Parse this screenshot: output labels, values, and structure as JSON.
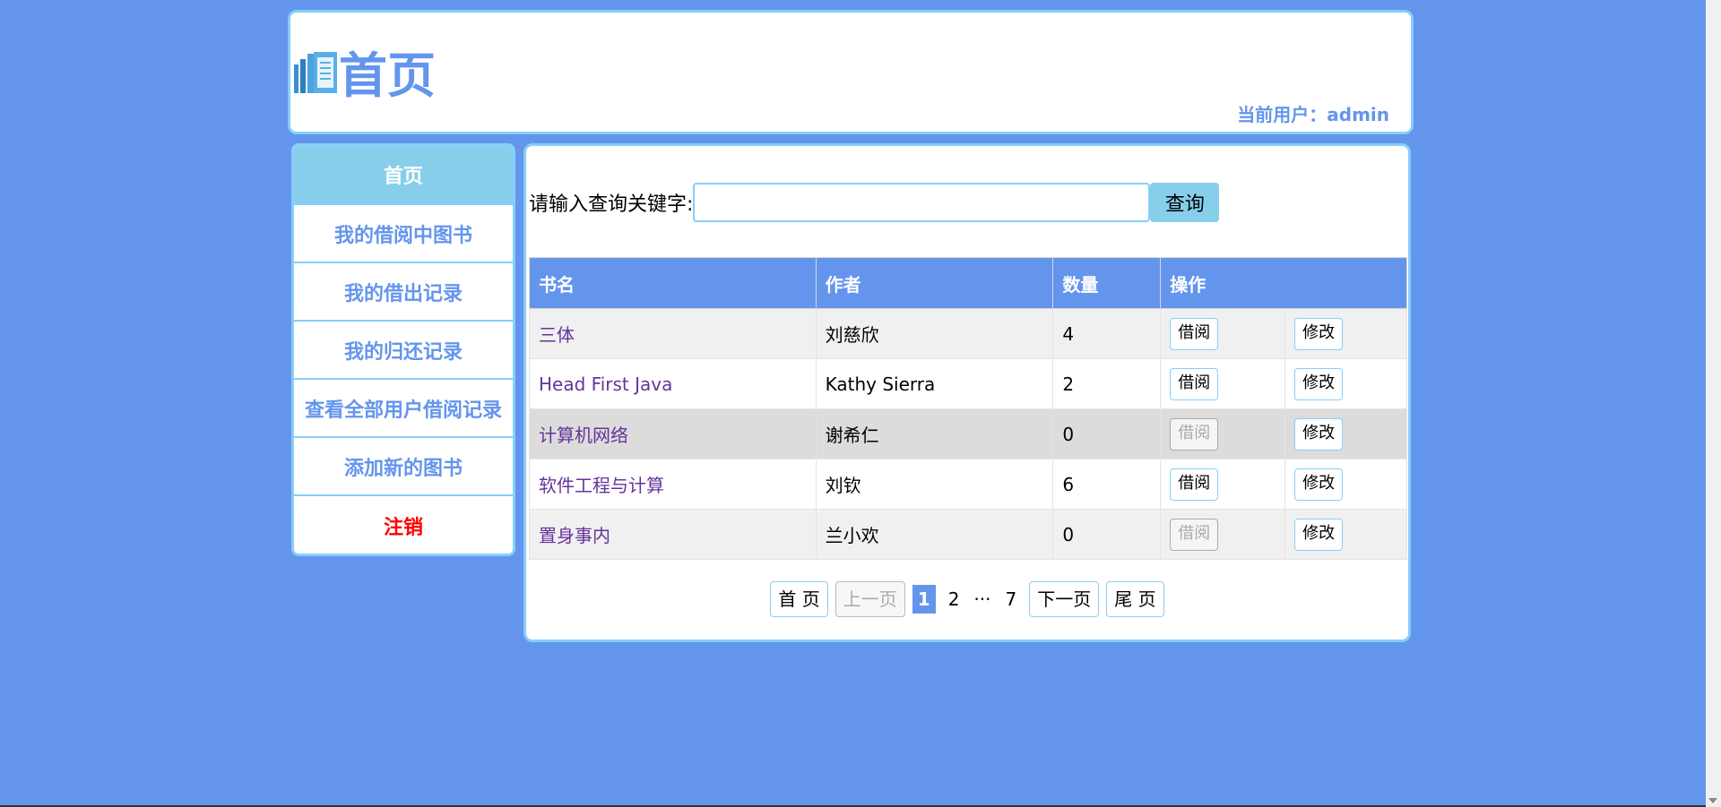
{
  "header": {
    "title": "首页",
    "current_user_label": "当前用户：",
    "current_user": "admin"
  },
  "sidebar": {
    "items": [
      {
        "label": "首页",
        "active": true
      },
      {
        "label": "我的借阅中图书"
      },
      {
        "label": "我的借出记录"
      },
      {
        "label": "我的归还记录"
      },
      {
        "label": "查看全部用户借阅记录"
      },
      {
        "label": "添加新的图书"
      },
      {
        "label": "注销",
        "color": "#FF0000"
      }
    ]
  },
  "search": {
    "label": "请输入查询关键字:",
    "value": "",
    "button_label": "查询"
  },
  "table": {
    "headers": [
      "书名",
      "作者",
      "数量",
      "操作"
    ],
    "borrow_label": "借阅",
    "edit_label": "修改",
    "rows": [
      {
        "title": "三体",
        "author": "刘慈欣",
        "count": "4",
        "borrow_enabled": true
      },
      {
        "title": "Head First Java",
        "author": "Kathy Sierra",
        "count": "2",
        "borrow_enabled": true
      },
      {
        "title": "计算机网络",
        "author": "谢希仁",
        "count": "0",
        "borrow_enabled": false
      },
      {
        "title": "软件工程与计算",
        "author": "刘钦",
        "count": "6",
        "borrow_enabled": true
      },
      {
        "title": "置身事内",
        "author": "兰小欢",
        "count": "0",
        "borrow_enabled": false
      }
    ]
  },
  "pagination": {
    "first": "首 页",
    "prev": "上一页",
    "pages": [
      "1",
      "2"
    ],
    "current": "1",
    "ellipsis": "···",
    "last_page": "7",
    "next": "下一页",
    "last": "尾 页"
  },
  "colors": {
    "background": "#6495ED",
    "border": "#87CEFA",
    "accent": "#87CEEB",
    "logout": "#FF0000"
  }
}
